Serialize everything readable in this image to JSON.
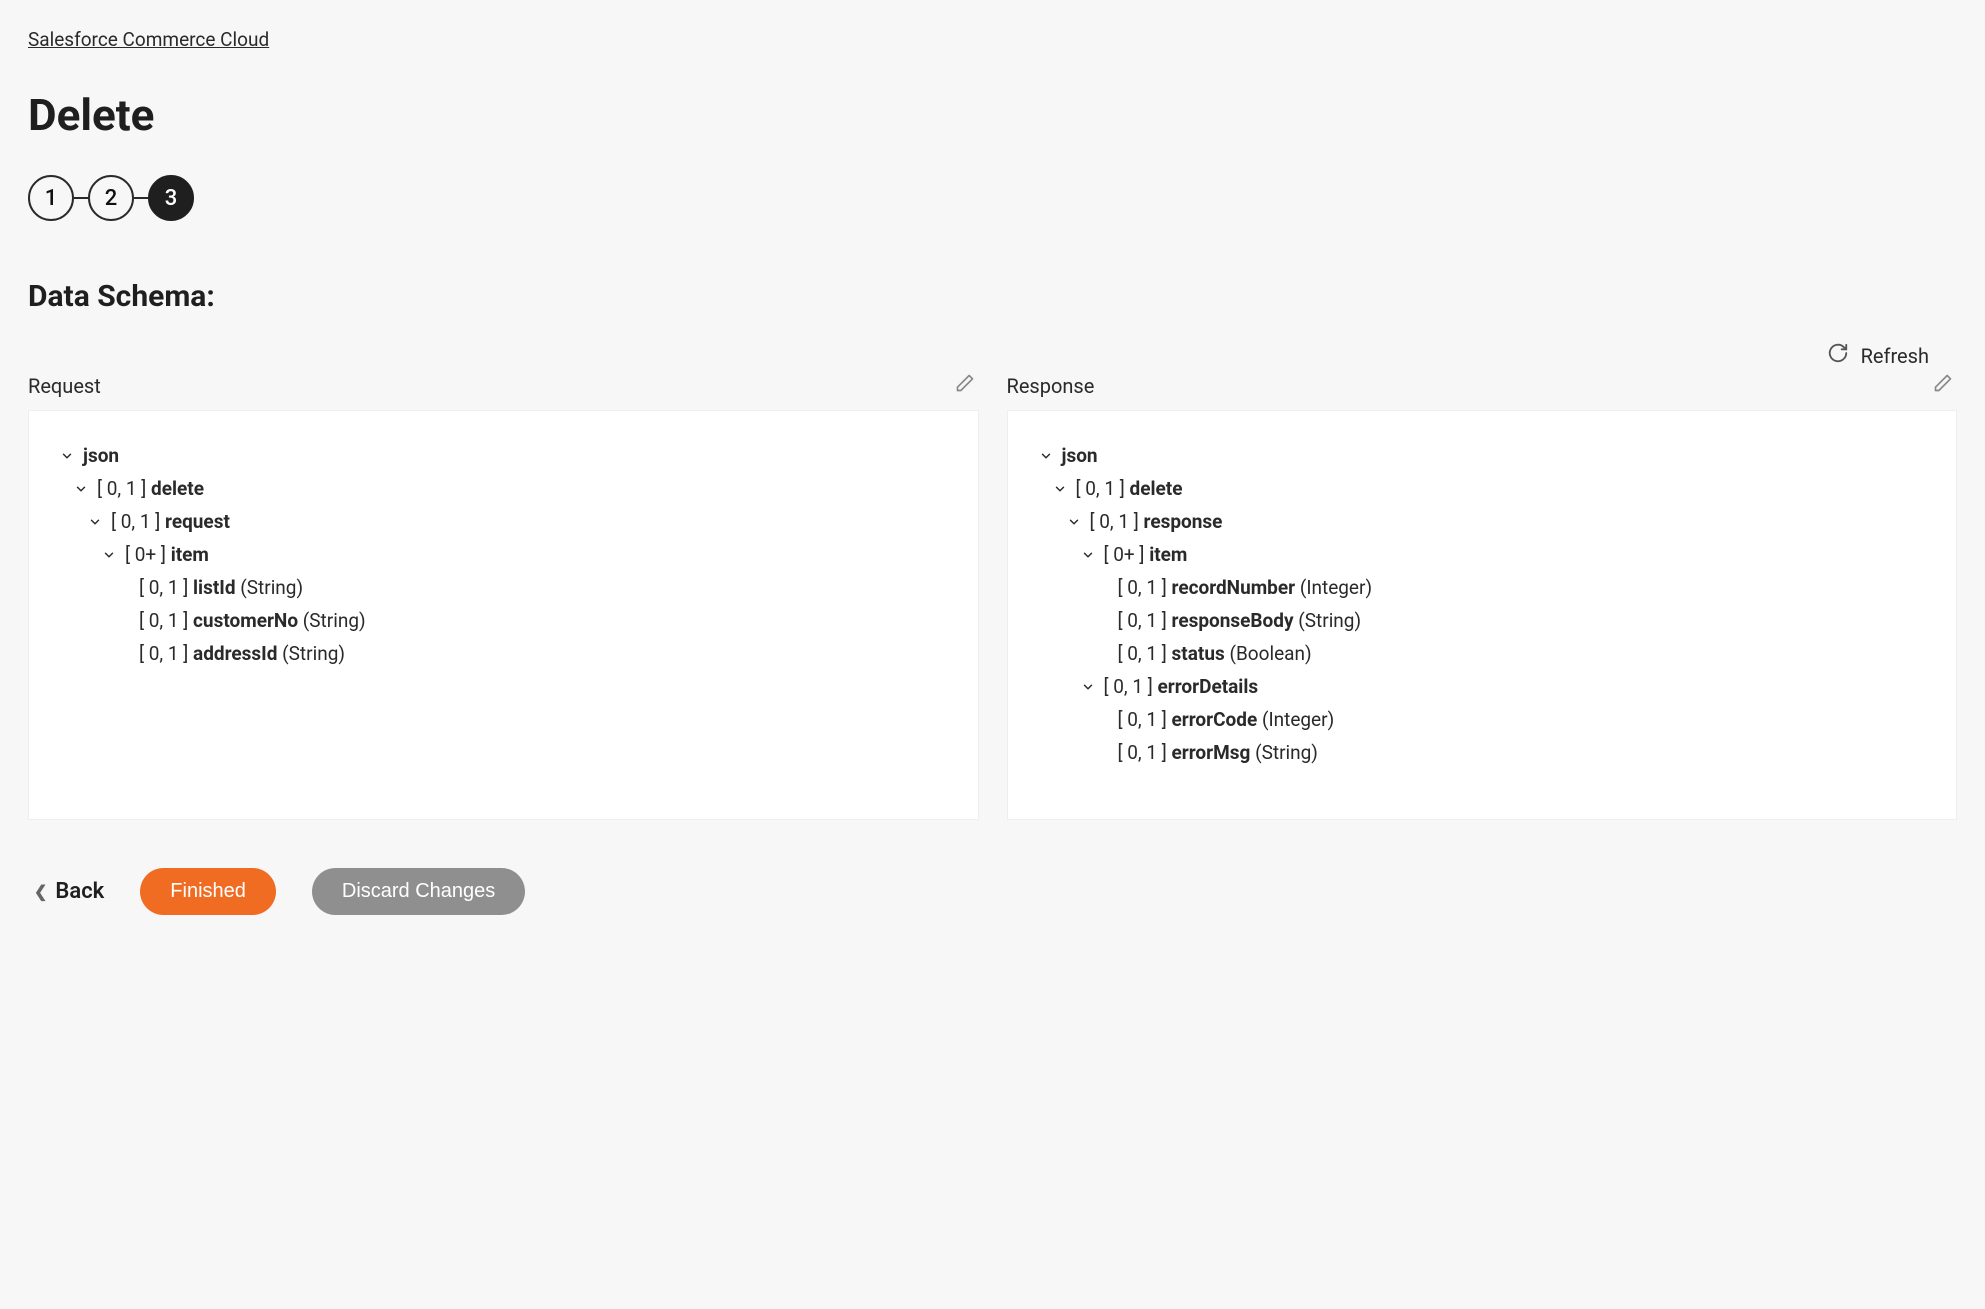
{
  "breadcrumb": "Salesforce Commerce Cloud",
  "page_title": "Delete",
  "stepper": {
    "steps": [
      "1",
      "2",
      "3"
    ],
    "active_index": 2
  },
  "section_heading": "Data Schema:",
  "refresh_label": "Refresh",
  "panels": {
    "request": {
      "title": "Request",
      "tree": [
        {
          "indent": 0,
          "chevron": true,
          "card": "",
          "name": "json",
          "type": ""
        },
        {
          "indent": 1,
          "chevron": true,
          "card": "[ 0, 1 ]",
          "name": "delete",
          "type": ""
        },
        {
          "indent": 2,
          "chevron": true,
          "card": "[ 0, 1 ]",
          "name": "request",
          "type": ""
        },
        {
          "indent": 3,
          "chevron": true,
          "card": "[ 0+ ]",
          "name": "item",
          "type": ""
        },
        {
          "indent": 4,
          "chevron": false,
          "card": "[ 0, 1 ]",
          "name": "listId",
          "type": "(String)"
        },
        {
          "indent": 4,
          "chevron": false,
          "card": "[ 0, 1 ]",
          "name": "customerNo",
          "type": "(String)"
        },
        {
          "indent": 4,
          "chevron": false,
          "card": "[ 0, 1 ]",
          "name": "addressId",
          "type": "(String)"
        }
      ]
    },
    "response": {
      "title": "Response",
      "tree": [
        {
          "indent": 0,
          "chevron": true,
          "card": "",
          "name": "json",
          "type": ""
        },
        {
          "indent": 1,
          "chevron": true,
          "card": "[ 0, 1 ]",
          "name": "delete",
          "type": ""
        },
        {
          "indent": 2,
          "chevron": true,
          "card": "[ 0, 1 ]",
          "name": "response",
          "type": ""
        },
        {
          "indent": 3,
          "chevron": true,
          "card": "[ 0+ ]",
          "name": "item",
          "type": ""
        },
        {
          "indent": 4,
          "chevron": false,
          "card": "[ 0, 1 ]",
          "name": "recordNumber",
          "type": "(Integer)"
        },
        {
          "indent": 4,
          "chevron": false,
          "card": "[ 0, 1 ]",
          "name": "responseBody",
          "type": "(String)"
        },
        {
          "indent": 4,
          "chevron": false,
          "card": "[ 0, 1 ]",
          "name": "status",
          "type": "(Boolean)"
        },
        {
          "indent": 3,
          "chevron": true,
          "card": "[ 0, 1 ]",
          "name": "errorDetails",
          "type": ""
        },
        {
          "indent": 4,
          "chevron": false,
          "card": "[ 0, 1 ]",
          "name": "errorCode",
          "type": "(Integer)"
        },
        {
          "indent": 4,
          "chevron": false,
          "card": "[ 0, 1 ]",
          "name": "errorMsg",
          "type": "(String)"
        }
      ]
    }
  },
  "footer": {
    "back": "Back",
    "finished": "Finished",
    "discard": "Discard Changes"
  }
}
